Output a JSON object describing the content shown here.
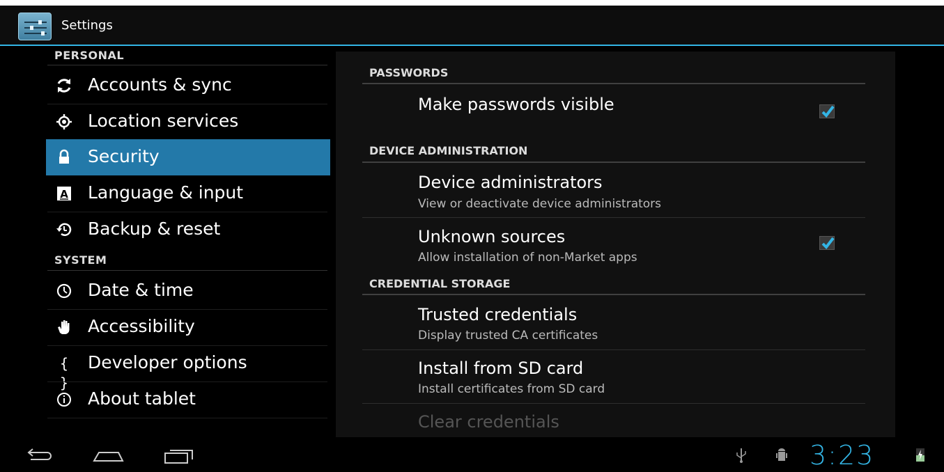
{
  "app": {
    "title": "Settings"
  },
  "sidebar": {
    "categories": {
      "personal": "PERSONAL",
      "system": "SYSTEM"
    },
    "items": [
      {
        "label": "Accounts & sync",
        "icon": "sync-icon"
      },
      {
        "label": "Location services",
        "icon": "location-icon"
      },
      {
        "label": "Security",
        "icon": "lock-icon",
        "selected": true
      },
      {
        "label": "Language & input",
        "icon": "keyboard-icon"
      },
      {
        "label": "Backup & reset",
        "icon": "backup-icon"
      },
      {
        "label": "Date & time",
        "icon": "clock-icon"
      },
      {
        "label": "Accessibility",
        "icon": "hand-icon"
      },
      {
        "label": "Developer options",
        "icon": "braces-icon"
      },
      {
        "label": "About tablet",
        "icon": "info-icon"
      }
    ]
  },
  "main": {
    "sections": {
      "passwords": "PASSWORDS",
      "device_admin": "DEVICE ADMINISTRATION",
      "credential_storage": "CREDENTIAL STORAGE"
    },
    "items": {
      "make_passwords_visible": {
        "title": "Make passwords visible",
        "checked": true
      },
      "device_administrators": {
        "title": "Device administrators",
        "summary": "View or deactivate device administrators"
      },
      "unknown_sources": {
        "title": "Unknown sources",
        "summary": "Allow installation of non-Market apps",
        "checked": true
      },
      "trusted_credentials": {
        "title": "Trusted credentials",
        "summary": "Display trusted CA certificates"
      },
      "install_from_sd": {
        "title": "Install from SD card",
        "summary": "Install certificates from SD card"
      },
      "clear_credentials": {
        "title": "Clear credentials",
        "enabled": false
      }
    }
  },
  "statusbar": {
    "time": "3:23",
    "icons": [
      "usb-icon",
      "debug-icon",
      "battery-icon"
    ]
  },
  "colors": {
    "accent": "#33b5e5",
    "selected": "#2379a9"
  }
}
